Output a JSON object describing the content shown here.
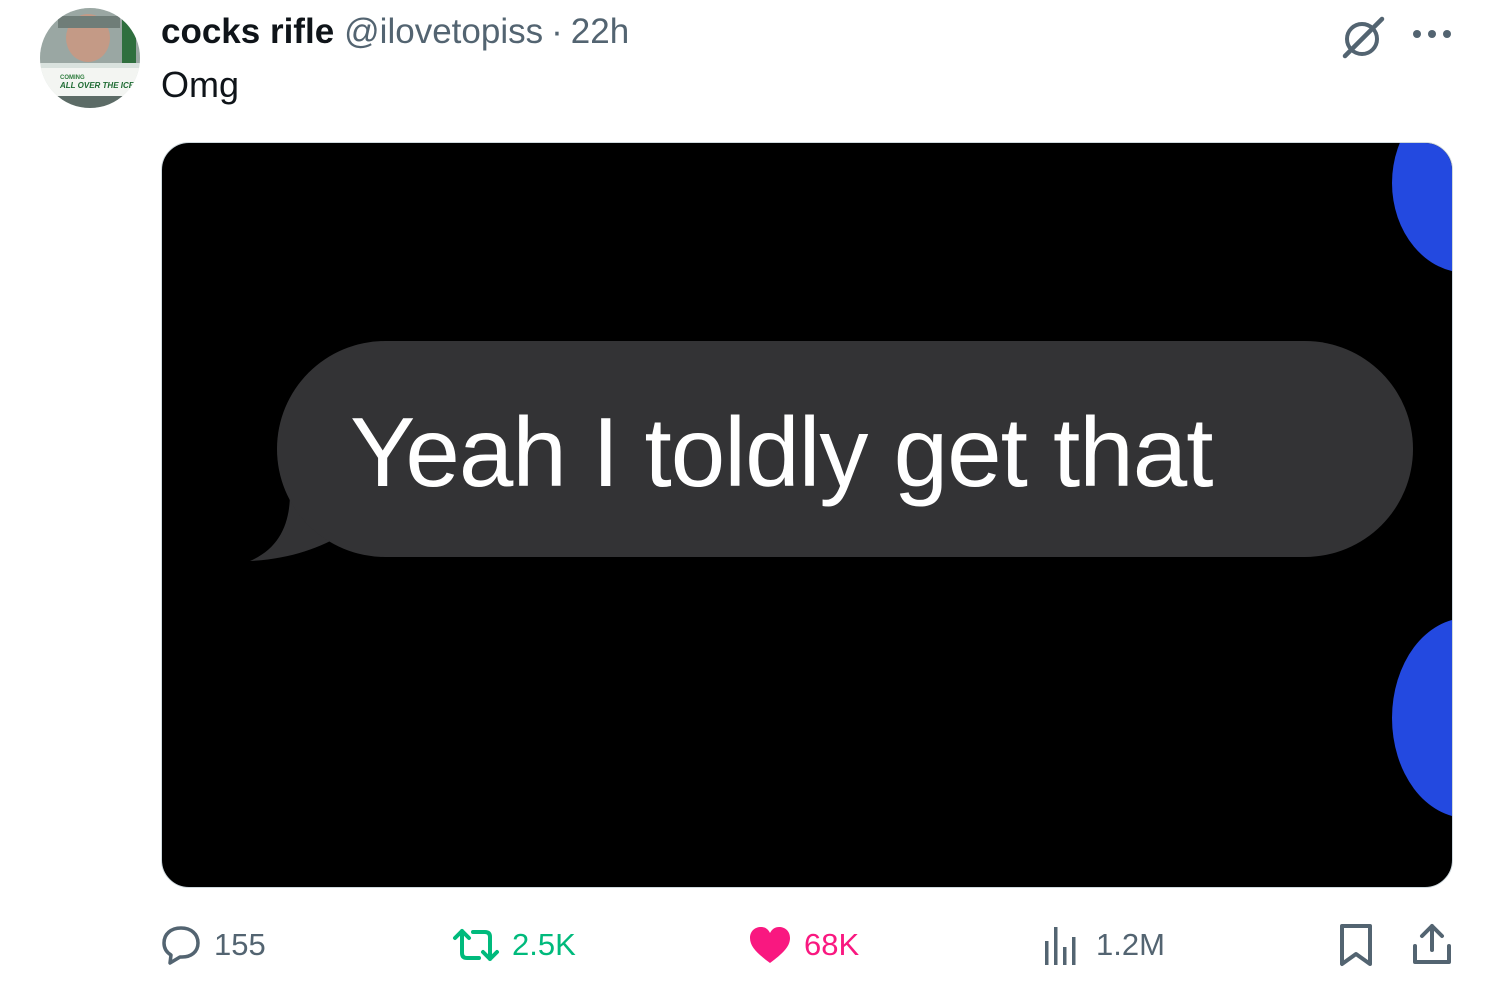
{
  "author": {
    "display_name": "cocks rifle",
    "handle": "@ilovetopiss",
    "separator": "·",
    "time": "22h",
    "avatar_banner_small": "COMING",
    "avatar_banner_large": "ALL OVER THE ICE"
  },
  "tweet": {
    "text": "Omg"
  },
  "media": {
    "message_text": "Yeah I toldly get that",
    "bubble_color": "#333335",
    "accent_dot_color": "#2349e0"
  },
  "actions": {
    "reply_count": "155",
    "retweet_count": "2.5K",
    "like_count": "68K",
    "views_count": "1.2M"
  },
  "colors": {
    "text_primary": "#0f1419",
    "text_secondary": "#536471",
    "retweet_active": "#00ba7c",
    "like_active": "#f91880"
  },
  "icons": [
    "grok-icon",
    "more-icon",
    "reply-icon",
    "retweet-icon",
    "like-icon",
    "views-icon",
    "bookmark-icon",
    "share-icon"
  ]
}
